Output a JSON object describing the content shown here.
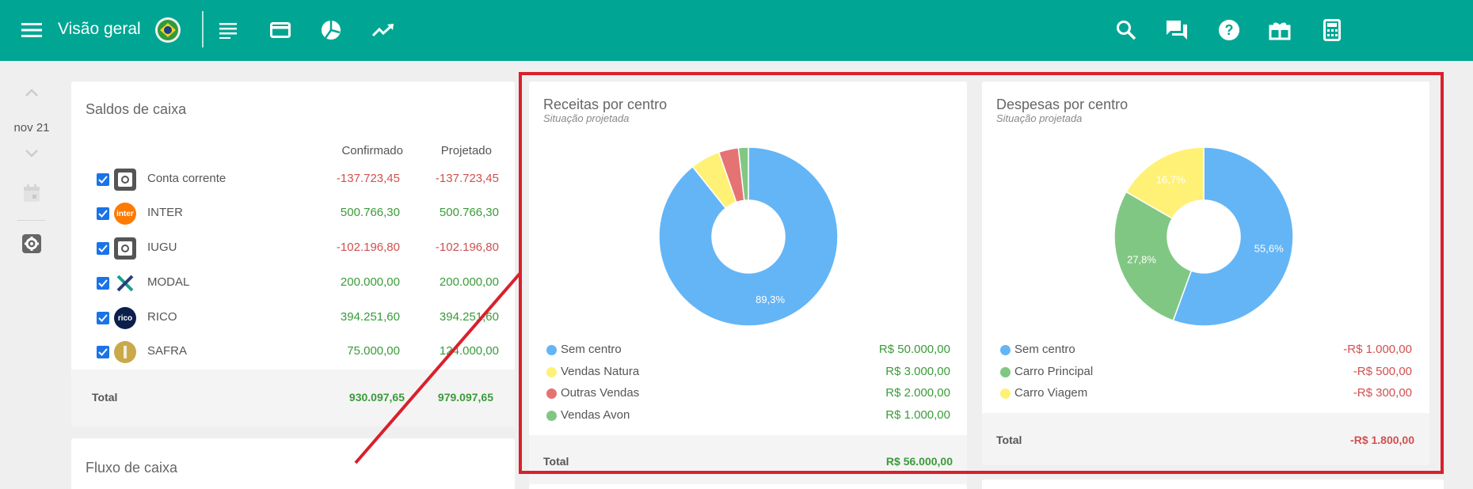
{
  "header": {
    "title": "Visão geral",
    "icons": [
      "menu-icon",
      "flag-icon",
      "list-icon",
      "card-icon",
      "pie-icon",
      "trend-icon",
      "search-icon",
      "chat-icon",
      "help-icon",
      "gift-icon",
      "calculator-icon"
    ]
  },
  "rail": {
    "date": "nov 21"
  },
  "saldos": {
    "title": "Saldos de caixa",
    "col_confirmado": "Confirmado",
    "col_projetado": "Projetado",
    "accounts": [
      {
        "name": "Conta corrente",
        "confirmado": "-137.723,45",
        "projetado": "-137.723,45",
        "logo_text": ""
      },
      {
        "name": "INTER",
        "confirmado": "500.766,30",
        "projetado": "500.766,30",
        "logo_text": "inter"
      },
      {
        "name": "IUGU",
        "confirmado": "-102.196,80",
        "projetado": "-102.196,80",
        "logo_text": ""
      },
      {
        "name": "MODAL",
        "confirmado": "200.000,00",
        "projetado": "200.000,00",
        "logo_text": ""
      },
      {
        "name": "RICO",
        "confirmado": "394.251,60",
        "projetado": "394.251,60",
        "logo_text": "rico"
      },
      {
        "name": "SAFRA",
        "confirmado": "75.000,00",
        "projetado": "124.000,00",
        "logo_text": ""
      }
    ],
    "total_label": "Total",
    "total_confirmado": "930.097,65",
    "total_projetado": "979.097,65"
  },
  "fluxo": {
    "title": "Fluxo de caixa"
  },
  "receitas": {
    "title": "Receitas por centro",
    "subtitle": "Situação projetada",
    "items": [
      {
        "name": "Sem centro",
        "value": "R$ 50.000,00",
        "color": "#64b5f6"
      },
      {
        "name": "Vendas Natura",
        "value": "R$ 3.000,00",
        "color": "#fff176"
      },
      {
        "name": "Outras Vendas",
        "value": "R$ 2.000,00",
        "color": "#e57373"
      },
      {
        "name": "Vendas Avon",
        "value": "R$ 1.000,00",
        "color": "#81c784"
      }
    ],
    "total_label": "Total",
    "total_value": "R$ 56.000,00",
    "pct_label": "89,3%"
  },
  "despesas": {
    "title": "Despesas por centro",
    "subtitle": "Situação projetada",
    "items": [
      {
        "name": "Sem centro",
        "value": "-R$ 1.000,00",
        "color": "#64b5f6"
      },
      {
        "name": "Carro Principal",
        "value": "-R$ 500,00",
        "color": "#81c784"
      },
      {
        "name": "Carro Viagem",
        "value": "-R$ 300,00",
        "color": "#fff176"
      }
    ],
    "total_label": "Total",
    "total_value": "-R$ 1.800,00",
    "pct_labels": [
      "55,6%",
      "27,8%",
      "16,7%"
    ]
  },
  "chart_data": [
    {
      "type": "pie",
      "categories": [
        "Sem centro",
        "Vendas Natura",
        "Outras Vendas",
        "Vendas Avon"
      ],
      "values": [
        50000,
        3000,
        2000,
        1000
      ],
      "title": "Receitas por centro",
      "subtitle": "Situação projetada"
    },
    {
      "type": "pie",
      "categories": [
        "Sem centro",
        "Carro Principal",
        "Carro Viagem"
      ],
      "values": [
        1000,
        500,
        300
      ],
      "title": "Despesas por centro",
      "subtitle": "Situação projetada"
    }
  ],
  "colors": {
    "brand": "#00a693",
    "negative": "#d0504f",
    "positive": "#3a9b3a",
    "highlight": "#d9202c"
  }
}
